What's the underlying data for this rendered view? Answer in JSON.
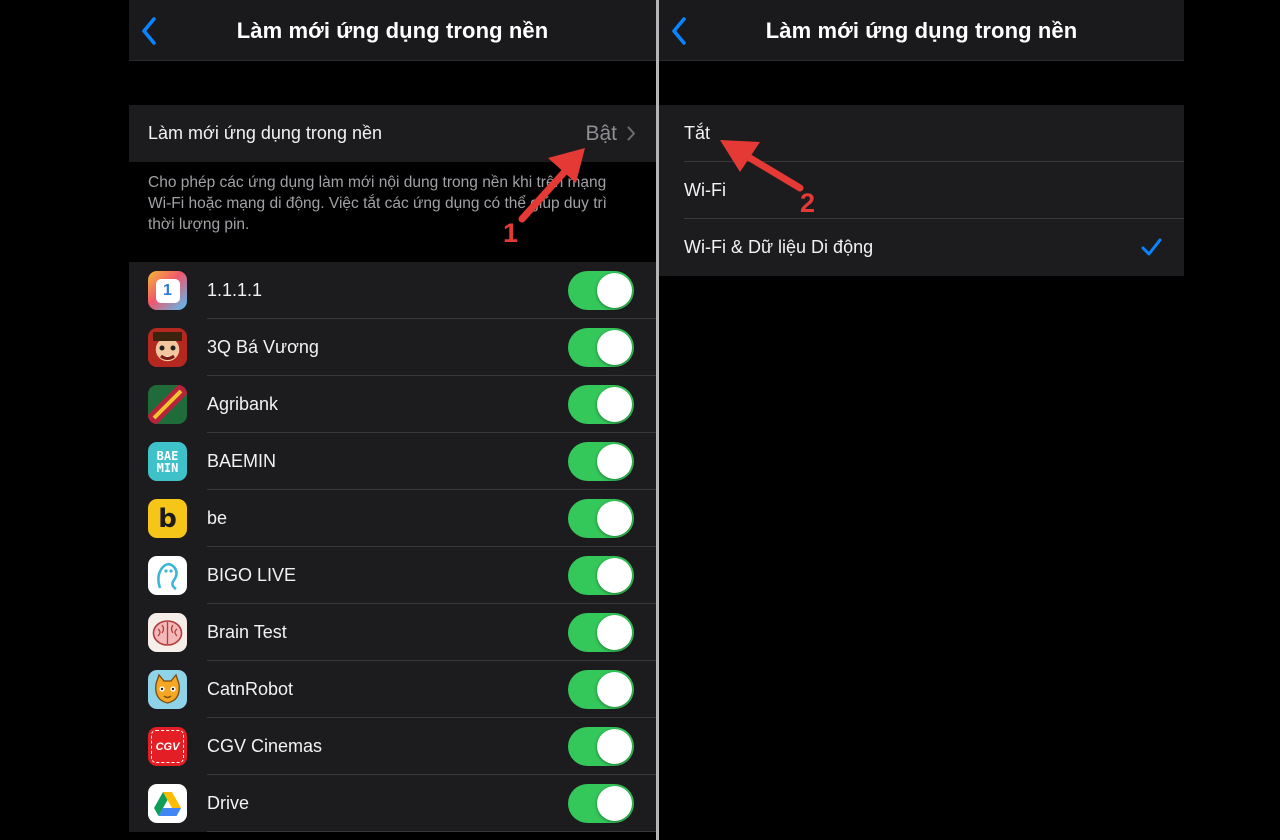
{
  "left": {
    "title": "Làm mới ứng dụng trong nền",
    "setting_label": "Làm mới ứng dụng trong nền",
    "setting_value": "Bật",
    "description": "Cho phép các ứng dụng làm mới nội dung trong nền khi trên mạng Wi-Fi hoặc mạng di động. Việc tắt các ứng dụng có thể giúp duy trì thời lượng pin.",
    "apps": [
      {
        "name": "1.1.1.1",
        "icon": "cloudflare-1111-icon",
        "enabled": true
      },
      {
        "name": "3Q Bá Vương",
        "icon": "3q-ba-vuong-icon",
        "enabled": true
      },
      {
        "name": "Agribank",
        "icon": "agribank-icon",
        "enabled": true
      },
      {
        "name": "BAEMIN",
        "icon": "baemin-icon",
        "enabled": true
      },
      {
        "name": "be",
        "icon": "be-icon",
        "enabled": true
      },
      {
        "name": "BIGO LIVE",
        "icon": "bigo-live-icon",
        "enabled": true
      },
      {
        "name": "Brain Test",
        "icon": "brain-test-icon",
        "enabled": true
      },
      {
        "name": "CatnRobot",
        "icon": "catnrobot-icon",
        "enabled": true
      },
      {
        "name": "CGV Cinemas",
        "icon": "cgv-icon",
        "enabled": true
      },
      {
        "name": "Drive",
        "icon": "google-drive-icon",
        "enabled": true
      }
    ]
  },
  "right": {
    "title": "Làm mới ứng dụng trong nền",
    "options": [
      {
        "label": "Tắt",
        "selected": false
      },
      {
        "label": "Wi-Fi",
        "selected": false
      },
      {
        "label": "Wi-Fi & Dữ liệu Di động",
        "selected": true
      }
    ]
  },
  "annotations": {
    "step1": "1",
    "step2": "2"
  },
  "icon_text": {
    "one_one": "1",
    "baemin": "BAE\nMIN",
    "be": "b",
    "cgv": "CGV"
  },
  "colors": {
    "accent": "#0a84ff",
    "toggle_on": "#34c759",
    "annotation": "#e53935",
    "cell_bg": "#1c1c1e"
  }
}
